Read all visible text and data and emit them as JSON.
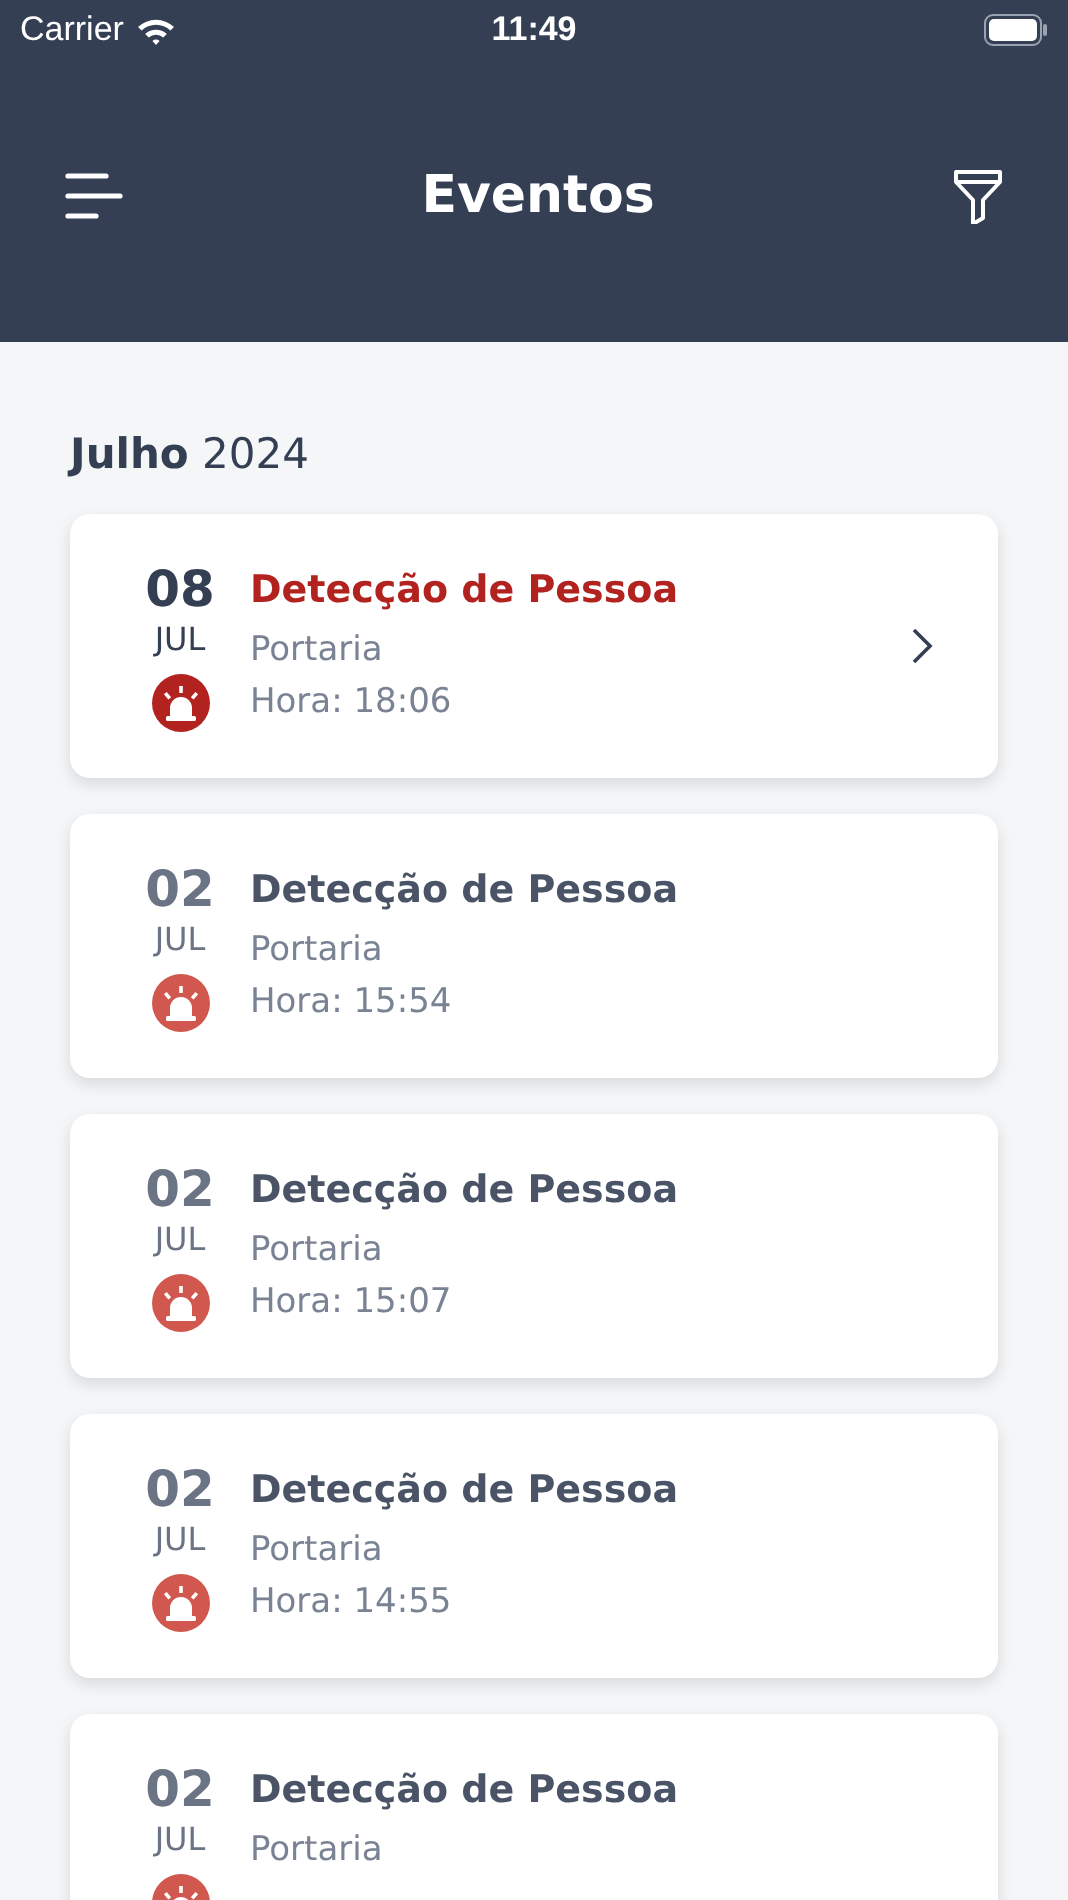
{
  "status_bar": {
    "carrier": "Carrier",
    "time": "11:49"
  },
  "header": {
    "title": "Eventos"
  },
  "month": "**Julho** 2024",
  "events": [
    {
      "day": "08",
      "month": "JUL",
      "title": "Detecção de Pessoa",
      "place": "Portaria",
      "time": "Hora: 18:06",
      "unread": true
    },
    {
      "day": "02",
      "month": "JUL",
      "title": "Detecção de Pessoa",
      "place": "Portaria",
      "time": "Hora: 15:54",
      "unread": false
    },
    {
      "day": "02",
      "month": "JUL",
      "title": "Detecção de Pessoa",
      "place": "Portaria",
      "time": "Hora: 15:07",
      "unread": false
    },
    {
      "day": "02",
      "month": "JUL",
      "title": "Detecção de Pessoa",
      "place": "Portaria",
      "time": "Hora: 14:55",
      "unread": false
    },
    {
      "day": "02",
      "month": "JUL",
      "title": "Detecção de Pessoa",
      "place": "Portaria",
      "unread": false
    }
  ]
}
